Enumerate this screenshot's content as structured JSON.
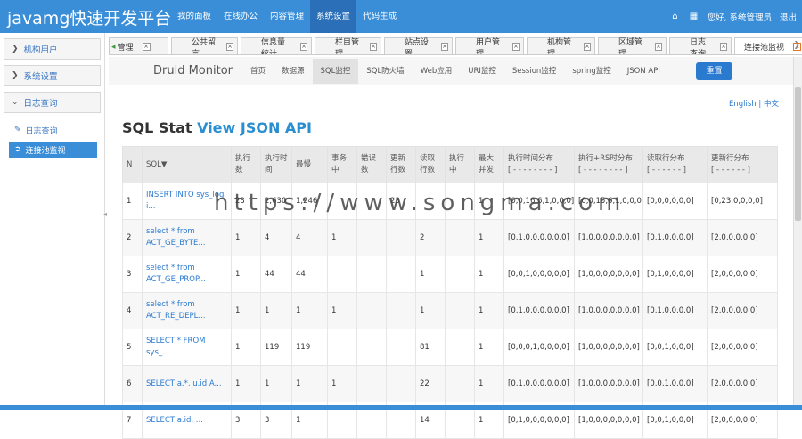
{
  "app": {
    "title": "javamg快速开发平台"
  },
  "topnav": [
    {
      "label": "我的面板"
    },
    {
      "label": "在线办公"
    },
    {
      "label": "内容管理"
    },
    {
      "label": "系统设置",
      "active": true
    },
    {
      "label": "代码生成"
    }
  ],
  "topright": {
    "greeting": "您好, 系统管理员",
    "logout": "退出"
  },
  "sidebar": {
    "groups": [
      {
        "label": "机构用户"
      },
      {
        "label": "系统设置"
      },
      {
        "label": "日志查询"
      }
    ],
    "items": [
      {
        "label": "日志查询"
      },
      {
        "label": "连接池监视"
      }
    ]
  },
  "tabs": [
    {
      "label": "管理"
    },
    {
      "label": "公共留言"
    },
    {
      "label": "信息量统计"
    },
    {
      "label": "栏目管理"
    },
    {
      "label": "站点设置"
    },
    {
      "label": "用户管理"
    },
    {
      "label": "机构管理"
    },
    {
      "label": "区域管理"
    },
    {
      "label": "日志查询"
    },
    {
      "label": "连接池监视"
    }
  ],
  "druid": {
    "title": "Druid Monitor",
    "nav": [
      "首页",
      "数据源",
      "SQL监控",
      "SQL防火墙",
      "Web应用",
      "URI监控",
      "Session监控",
      "spring监控",
      "JSON API"
    ],
    "reset": "重置"
  },
  "lang": {
    "en": "English",
    "sep": "|",
    "zh": "中文"
  },
  "sqlstat": {
    "title": "SQL Stat",
    "link": "View JSON API"
  },
  "table": {
    "headers": [
      [
        "N",
        ""
      ],
      [
        "SQL▼",
        ""
      ],
      [
        "执行",
        "数"
      ],
      [
        "执行时",
        "间"
      ],
      [
        "最慢",
        ""
      ],
      [
        "事务",
        "中"
      ],
      [
        "错误",
        "数"
      ],
      [
        "更新",
        "行数"
      ],
      [
        "读取",
        "行数"
      ],
      [
        "执行",
        "中"
      ],
      [
        "最大",
        "并发"
      ],
      [
        "执行时间分布",
        "[ - - - - - - - - ]"
      ],
      [
        "执行+RS时分布",
        "[ - - - - - - - - ]"
      ],
      [
        "读取行分布",
        "[ - - - - - - ]"
      ],
      [
        "更新行分布",
        "[ - - - - - - ]"
      ]
    ],
    "rows": [
      [
        "1",
        "INSERT INTO sys_logi\ni...",
        "23",
        "2,630",
        "1,246",
        "",
        "",
        "23",
        "",
        "",
        "1",
        "[0,0,16,6,1,0,0,0]",
        "[0,0,15,6,1,0,0,0]",
        "[0,0,0,0,0,0]",
        "[0,23,0,0,0,0]"
      ],
      [
        "2",
        "select * from\nACT_GE_BYTE...",
        "1",
        "4",
        "4",
        "1",
        "",
        "",
        "2",
        "",
        "1",
        "[0,1,0,0,0,0,0,0]",
        "[1,0,0,0,0,0,0,0]",
        "[0,1,0,0,0,0]",
        "[2,0,0,0,0,0]"
      ],
      [
        "3",
        "select * from\nACT_GE_PROP...",
        "1",
        "44",
        "44",
        "",
        "",
        "",
        "1",
        "",
        "1",
        "[0,0,1,0,0,0,0,0]",
        "[1,0,0,0,0,0,0,0]",
        "[0,1,0,0,0,0]",
        "[2,0,0,0,0,0]"
      ],
      [
        "4",
        "select * from\nACT_RE_DEPL...",
        "1",
        "1",
        "1",
        "1",
        "",
        "",
        "1",
        "",
        "1",
        "[0,1,0,0,0,0,0,0]",
        "[1,0,0,0,0,0,0,0]",
        "[0,1,0,0,0,0]",
        "[2,0,0,0,0,0]"
      ],
      [
        "5",
        "SELECT * FROM\nsys_...",
        "1",
        "119",
        "119",
        "",
        "",
        "",
        "81",
        "",
        "1",
        "[0,0,0,1,0,0,0,0]",
        "[1,0,0,0,0,0,0,0]",
        "[0,0,1,0,0,0]",
        "[2,0,0,0,0,0]"
      ],
      [
        "6",
        "SELECT a.*, u.id A...",
        "1",
        "1",
        "1",
        "1",
        "",
        "",
        "22",
        "",
        "1",
        "[0,1,0,0,0,0,0,0]",
        "[1,0,0,0,0,0,0,0]",
        "[0,0,1,0,0,0]",
        "[2,0,0,0,0,0]"
      ],
      [
        "7",
        "SELECT a.id, ...",
        "3",
        "3",
        "1",
        "",
        "",
        "",
        "14",
        "",
        "1",
        "[0,1,0,0,0,0,0,0]",
        "[1,0,0,0,0,0,0,0]",
        "[0,0,1,0,0,0]",
        "[2,0,0,0,0,0]"
      ]
    ]
  },
  "watermark": "https://www.songma.com",
  "icons": {
    "home": "home-icon",
    "grid": "grid-icon"
  },
  "colors": {
    "topbar": "#3a8ed8",
    "accent": "#2a7ad0"
  }
}
